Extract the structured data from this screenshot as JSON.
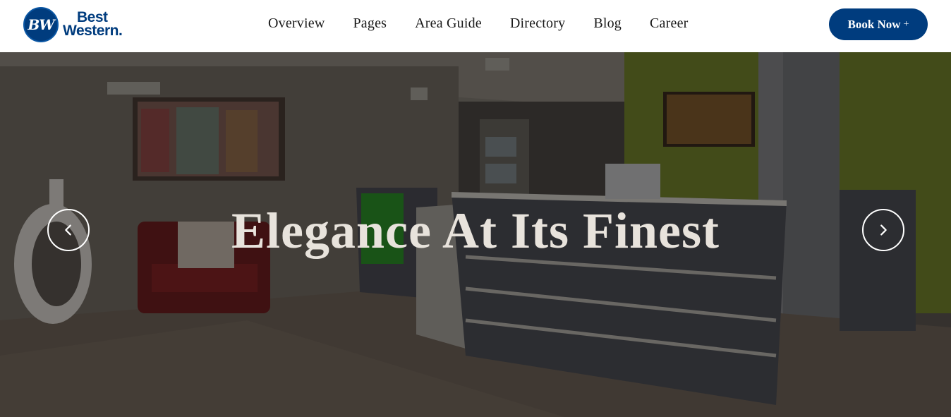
{
  "header": {
    "logo": {
      "mark": "BW",
      "line1": "Best",
      "line2": "Western."
    },
    "nav": [
      "Overview",
      "Pages",
      "Area Guide",
      "Directory",
      "Blog",
      "Career"
    ],
    "book_label": "Book Now",
    "book_icon": "plus"
  },
  "hero": {
    "title": "Elegance At Its Finest",
    "prev_icon": "chevron-left-icon",
    "next_icon": "chevron-right-icon"
  },
  "colors": {
    "brand": "#003c7e",
    "title": "#e8e3dc"
  }
}
